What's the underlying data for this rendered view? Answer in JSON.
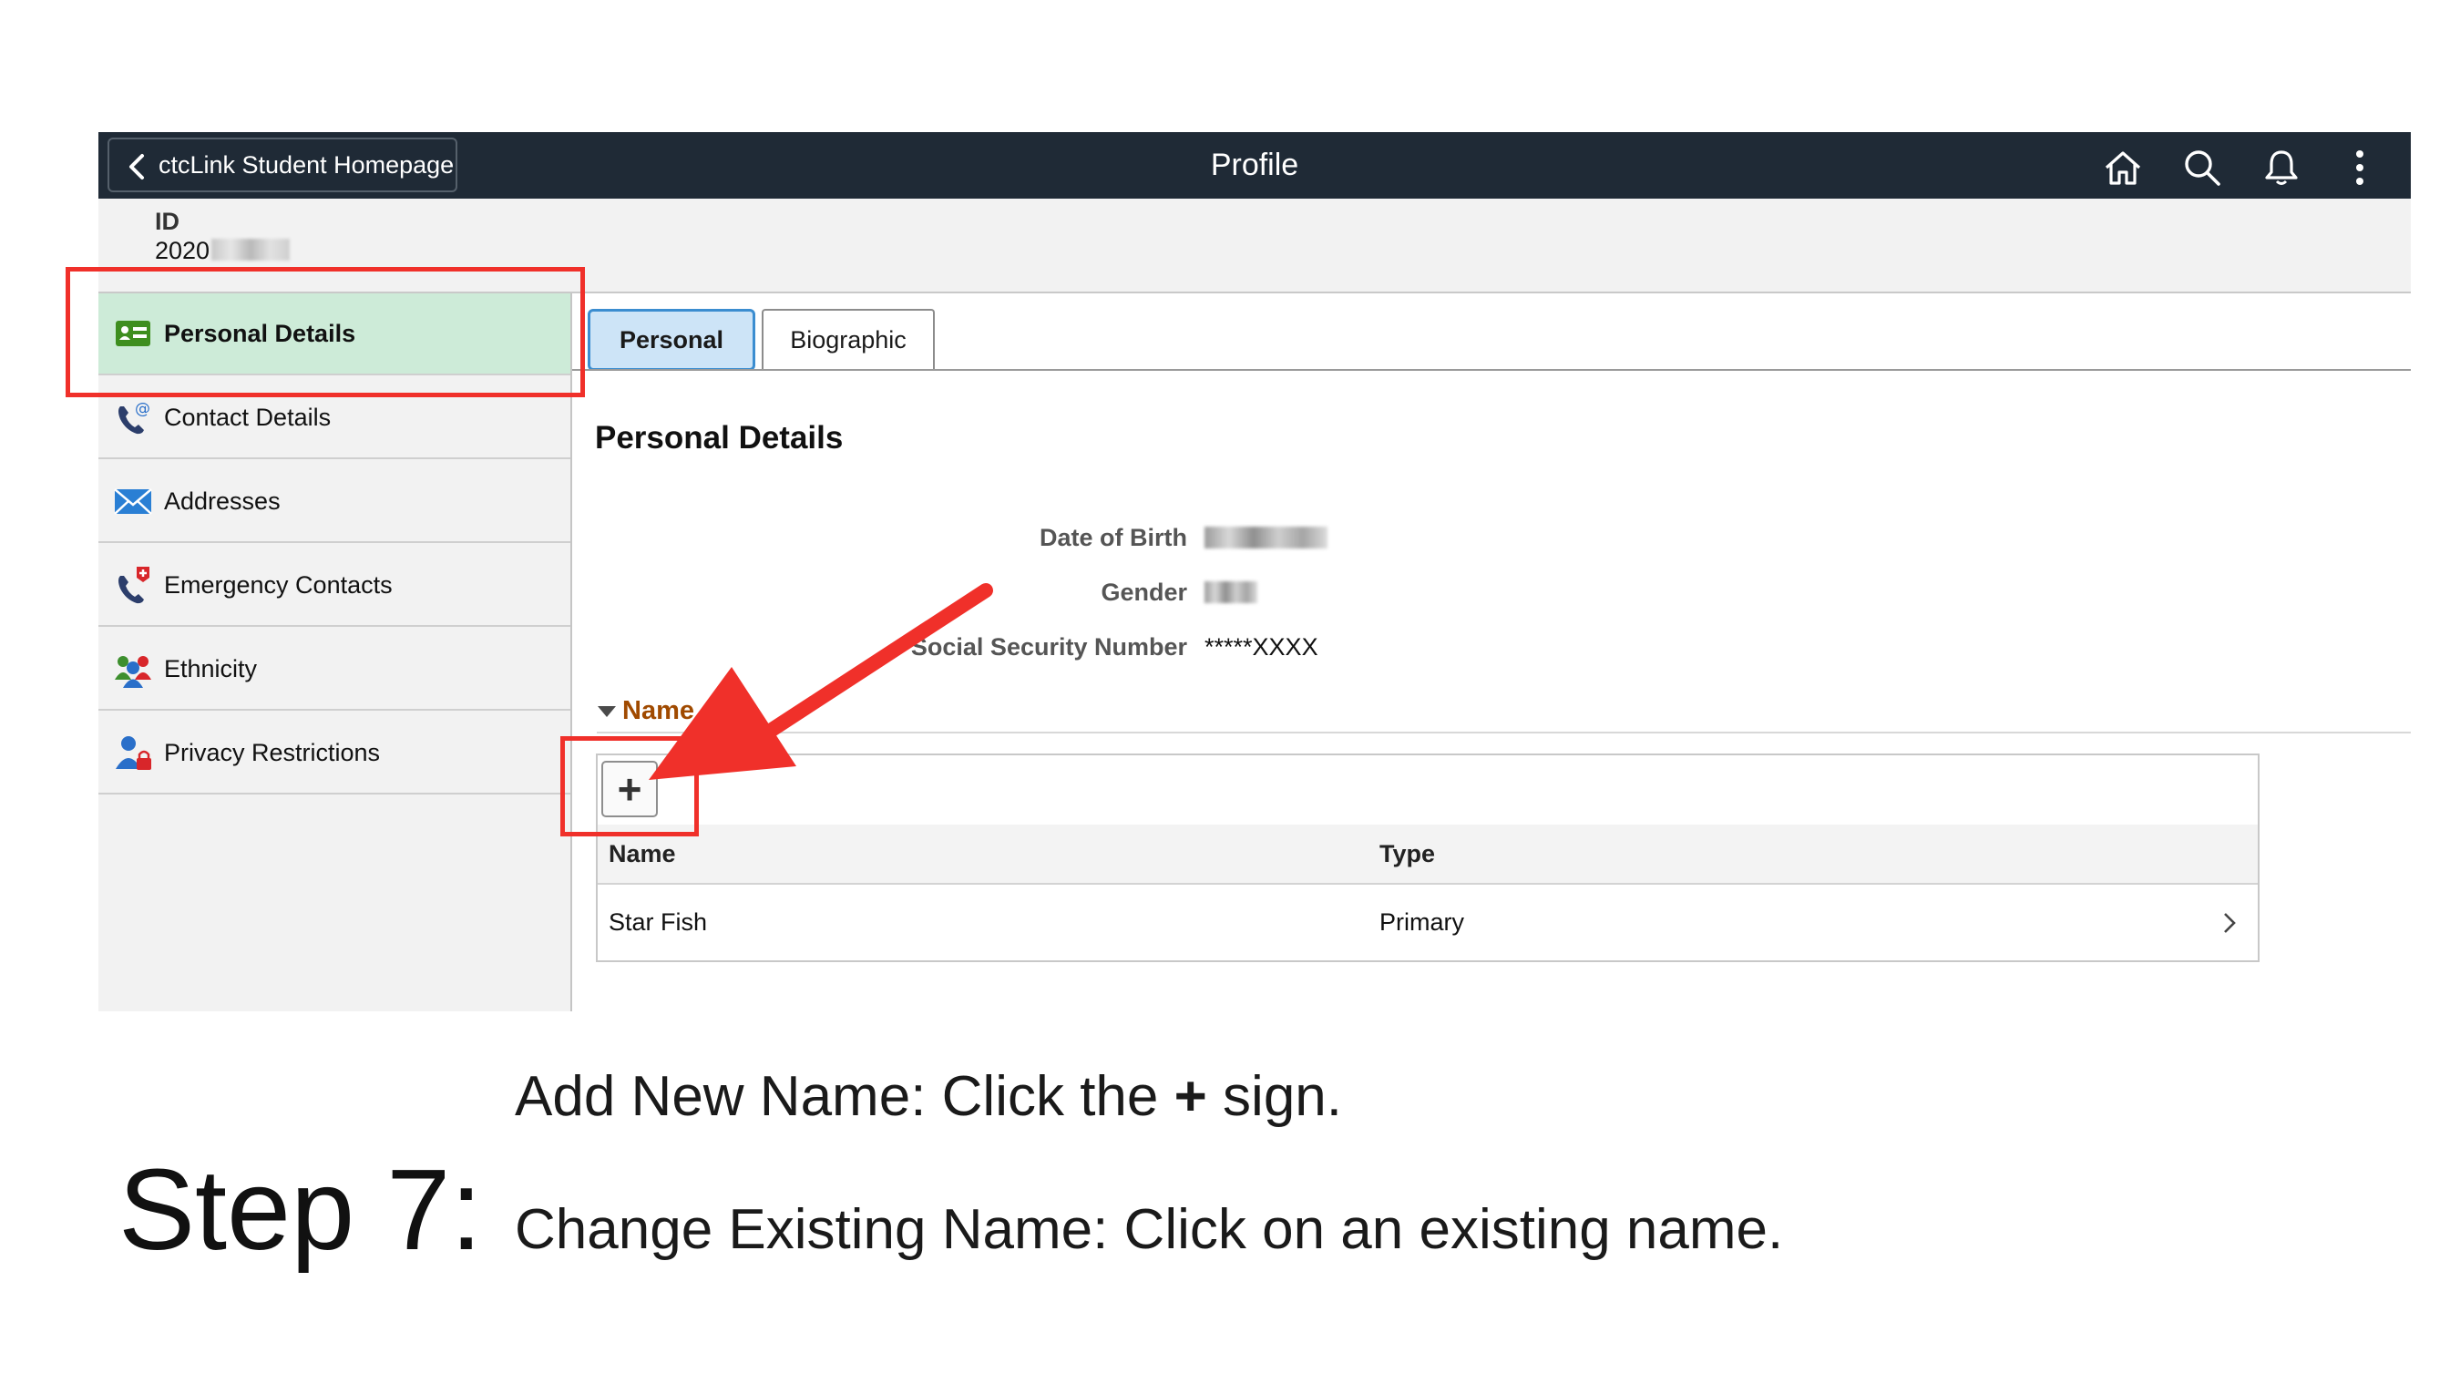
{
  "header": {
    "back_label": "ctcLink Student Homepage",
    "title": "Profile",
    "icons": [
      "home-icon",
      "search-icon",
      "bell-icon",
      "more-vertical-icon"
    ]
  },
  "id_block": {
    "label": "ID",
    "value_visible": "2020"
  },
  "sidebar": {
    "items": [
      {
        "label": "Personal Details",
        "icon": "id-card-icon",
        "active": true
      },
      {
        "label": "Contact Details",
        "icon": "phone-at-icon"
      },
      {
        "label": "Addresses",
        "icon": "envelope-icon"
      },
      {
        "label": "Emergency Contacts",
        "icon": "phone-medical-icon"
      },
      {
        "label": "Ethnicity",
        "icon": "people-icon"
      },
      {
        "label": "Privacy Restrictions",
        "icon": "person-lock-icon"
      }
    ]
  },
  "tabs": [
    {
      "label": "Personal",
      "active": true
    },
    {
      "label": "Biographic"
    }
  ],
  "main": {
    "section_title": "Personal Details",
    "fields": [
      {
        "label": "Date of Birth"
      },
      {
        "label": "Gender"
      },
      {
        "label": "Social Security Number",
        "value": "*****XXXX"
      }
    ],
    "name_section": {
      "toggle_label": "Name",
      "add_button": "+",
      "columns": [
        "Name",
        "Type"
      ],
      "rows": [
        {
          "name": "Star Fish",
          "type": "Primary"
        }
      ]
    }
  },
  "caption": {
    "add_bold": "Add New Name",
    "add_rest_1": ": Click the ",
    "add_plus": "+",
    "add_rest_2": " sign.",
    "step": "Step 7:",
    "change_bold": "Change Existing Name",
    "change_rest": ": Click on an existing name."
  },
  "colors": {
    "header_bg": "#1f2a36",
    "active_nav_bg": "#cdebd8",
    "highlight_red": "#f0302a",
    "name_toggle": "#a04a00"
  }
}
